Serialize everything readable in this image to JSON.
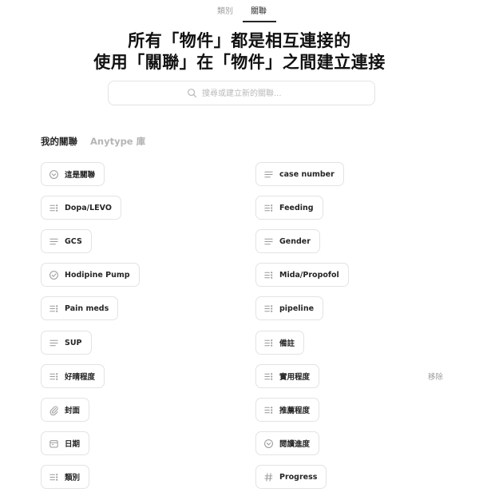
{
  "top_tabs": [
    {
      "label": "類別",
      "active": false
    },
    {
      "label": "關聯",
      "active": true
    }
  ],
  "hero": {
    "line1": "所有「物件」都是相互連接的",
    "line2": "使用「關聯」在「物件」之間建立連接"
  },
  "search": {
    "placeholder": "搜尋或建立新的關聯..."
  },
  "section_tabs": [
    {
      "label": "我的關聯",
      "active": true
    },
    {
      "label": "Anytype 庫",
      "active": false
    }
  ],
  "relations": {
    "left": [
      {
        "label": "這是關聯",
        "icon": "status-icon"
      },
      {
        "label": "Dopa/LEVO",
        "icon": "select-icon"
      },
      {
        "label": "GCS",
        "icon": "text-icon"
      },
      {
        "label": "Hodipine Pump",
        "icon": "checkbox-icon"
      },
      {
        "label": "Pain meds",
        "icon": "select-icon"
      },
      {
        "label": "SUP",
        "icon": "text-icon"
      },
      {
        "label": "好晴程度",
        "icon": "select-icon"
      },
      {
        "label": "封面",
        "icon": "paperclip-icon"
      },
      {
        "label": "日期",
        "icon": "calendar-icon"
      },
      {
        "label": "類別",
        "icon": "select-icon"
      }
    ],
    "right": [
      {
        "label": "case number",
        "icon": "text-icon"
      },
      {
        "label": "Feeding",
        "icon": "select-icon"
      },
      {
        "label": "Gender",
        "icon": "text-icon"
      },
      {
        "label": "Mida/Propofol",
        "icon": "select-icon"
      },
      {
        "label": "pipeline",
        "icon": "select-icon"
      },
      {
        "label": "備註",
        "icon": "select-icon"
      },
      {
        "label": "實用程度",
        "icon": "select-icon"
      },
      {
        "label": "推薦程度",
        "icon": "select-icon"
      },
      {
        "label": "閱讀進度",
        "icon": "status-icon"
      },
      {
        "label": "Progress",
        "icon": "number-icon"
      }
    ]
  },
  "remove_label": "移除",
  "colors": {
    "text": "#252525",
    "muted": "#a0a0a0",
    "border": "#e3e3e3",
    "icon": "#9a9a9a"
  }
}
